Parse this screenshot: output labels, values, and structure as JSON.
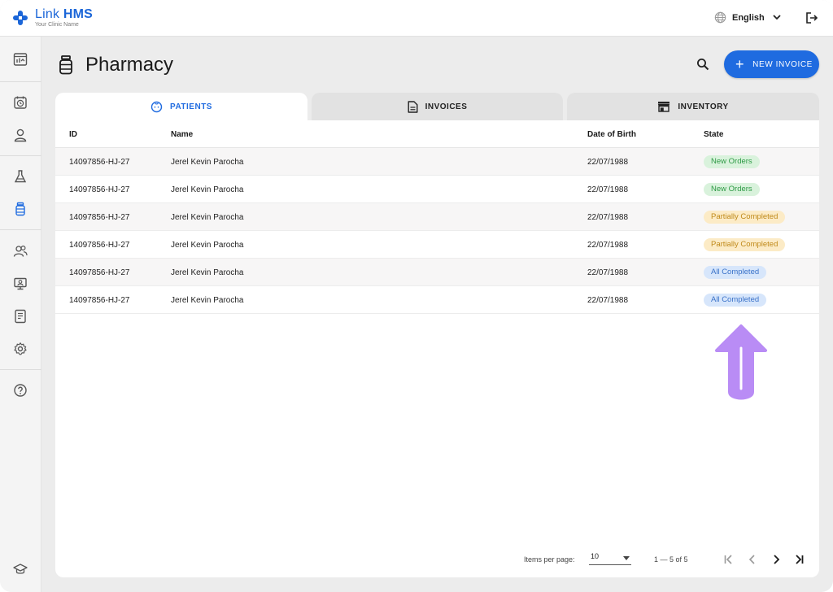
{
  "app": {
    "title_light": "Link",
    "title_bold": "HMS",
    "subtitle": "Your Clinic Name",
    "brand_color": "#1f6be0"
  },
  "topbar": {
    "language": "English",
    "globe_icon": "globe-icon",
    "logout_icon": "logout-icon"
  },
  "sidebar": {
    "items": [
      {
        "name": "dashboard",
        "icon": "dashboard-icon"
      },
      {
        "name": "appointments",
        "icon": "calendar-clock-icon"
      },
      {
        "name": "patients",
        "icon": "person-icon"
      },
      {
        "name": "laboratory",
        "icon": "flask-icon"
      },
      {
        "name": "pharmacy",
        "icon": "medicine-bottle-icon",
        "active": true
      },
      {
        "name": "staff",
        "icon": "people-icon"
      },
      {
        "name": "monitor",
        "icon": "monitor-icon"
      },
      {
        "name": "reports",
        "icon": "report-icon"
      },
      {
        "name": "settings",
        "icon": "gear-icon"
      },
      {
        "name": "help",
        "icon": "help-icon"
      },
      {
        "name": "training",
        "icon": "graduation-cap-icon"
      }
    ]
  },
  "page": {
    "title": "Pharmacy",
    "new_button": "NEW INVOICE"
  },
  "tabs": [
    {
      "label": "PATIENTS",
      "active": true
    },
    {
      "label": "INVOICES",
      "active": false
    },
    {
      "label": "INVENTORY",
      "active": false
    }
  ],
  "table": {
    "columns": [
      "ID",
      "Name",
      "Date of Birth",
      "State"
    ],
    "rows": [
      {
        "id": "14097856-HJ-27",
        "name": "Jerel Kevin Parocha",
        "dob": "22/07/1988",
        "state": "New Orders"
      },
      {
        "id": "14097856-HJ-27",
        "name": "Jerel Kevin Parocha",
        "dob": "22/07/1988",
        "state": "New Orders"
      },
      {
        "id": "14097856-HJ-27",
        "name": "Jerel Kevin Parocha",
        "dob": "22/07/1988",
        "state": "Partially Completed"
      },
      {
        "id": "14097856-HJ-27",
        "name": "Jerel Kevin Parocha",
        "dob": "22/07/1988",
        "state": "Partially Completed"
      },
      {
        "id": "14097856-HJ-27",
        "name": "Jerel Kevin Parocha",
        "dob": "22/07/1988",
        "state": "All Completed"
      },
      {
        "id": "14097856-HJ-27",
        "name": "Jerel Kevin Parocha",
        "dob": "22/07/1988",
        "state": "All Completed"
      }
    ],
    "state_colors": {
      "New Orders": {
        "bg": "#d9f2dc",
        "fg": "#2e9a45"
      },
      "Partially Completed": {
        "bg": "#fcebc6",
        "fg": "#c08a1a"
      },
      "All Completed": {
        "bg": "#d7e6fb",
        "fg": "#3a72c9"
      }
    }
  },
  "pagination": {
    "items_per_page_label": "Items per page:",
    "items_per_page": "10",
    "range": "1 — 5 of 5"
  },
  "annotation": {
    "arrow_color": "#b98cf5",
    "arrow_icon": "arrow-up-icon"
  }
}
